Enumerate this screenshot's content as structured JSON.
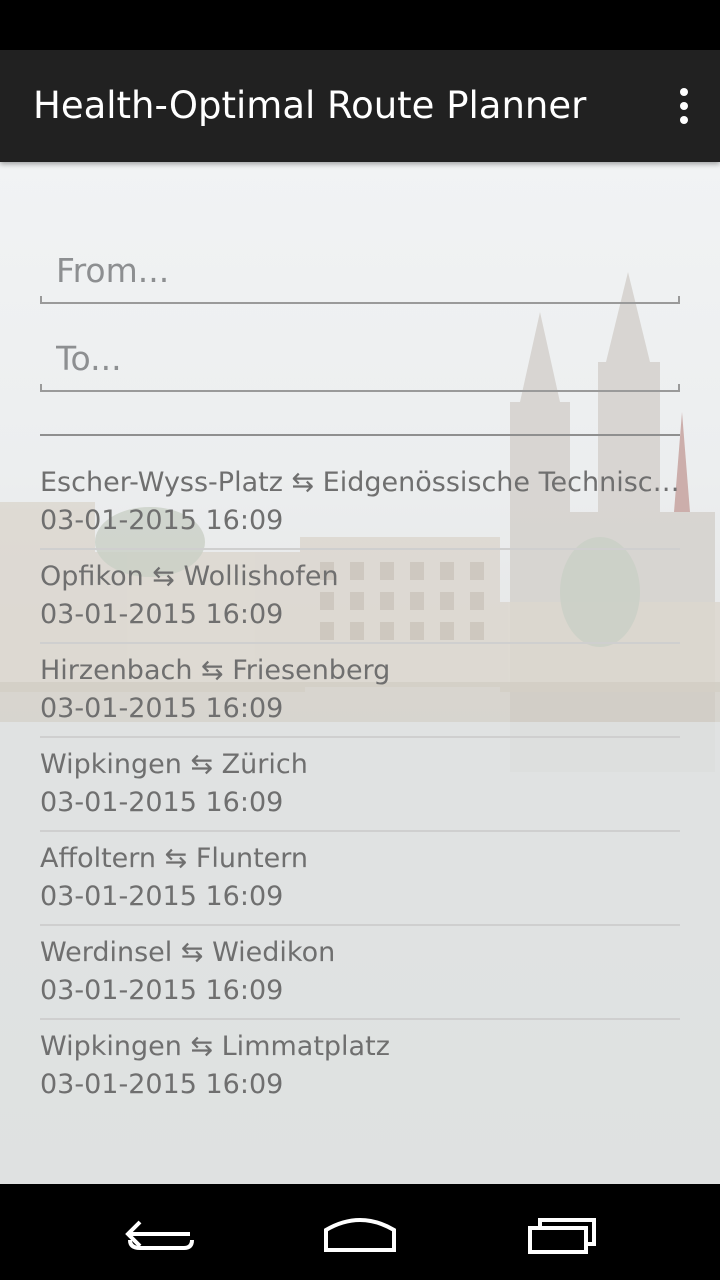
{
  "app_bar": {
    "title": "Health-Optimal Route Planner",
    "overflow_icon": "more-vert-icon"
  },
  "form": {
    "from_placeholder": "From...",
    "to_placeholder": "To..."
  },
  "history": [
    {
      "route": "Escher-Wyss-Platz ⇆ Eidgenössische Technisch…",
      "date": "03-01-2015 16:09"
    },
    {
      "route": "Opfikon ⇆ Wollishofen",
      "date": "03-01-2015 16:09"
    },
    {
      "route": "Hirzenbach ⇆ Friesenberg",
      "date": "03-01-2015 16:09"
    },
    {
      "route": "Wipkingen ⇆ Zürich",
      "date": "03-01-2015 16:09"
    },
    {
      "route": "Affoltern ⇆ Fluntern",
      "date": "03-01-2015 16:09"
    },
    {
      "route": "Werdinsel ⇆ Wiedikon",
      "date": "03-01-2015 16:09"
    },
    {
      "route": "Wipkingen ⇆ Limmatplatz",
      "date": "03-01-2015 16:09"
    }
  ],
  "nav_bar": {
    "back_icon": "back-icon",
    "home_icon": "home-icon",
    "recents_icon": "recent-apps-icon"
  },
  "colors": {
    "action_bar": "#212121",
    "text_secondary": "#6f6f6f"
  }
}
